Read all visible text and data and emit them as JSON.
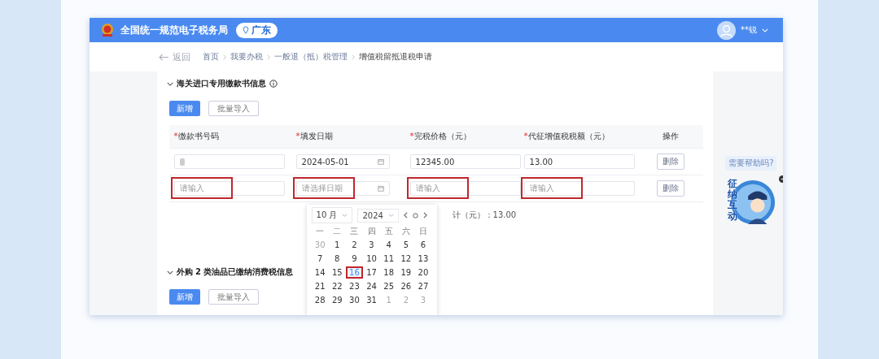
{
  "header": {
    "site_title": "全国统一规范电子税务局",
    "region": "广东",
    "user_name": "**锐"
  },
  "breadcrumb": {
    "back": "返回",
    "items": [
      "首页",
      "我要办税",
      "一般退（抵）税管理",
      "增值税留抵退税申请"
    ]
  },
  "section_1": {
    "title": "海关进口专用缴款书信息",
    "expanded": true,
    "buttons": [
      {
        "label": "新增",
        "kind": "primary"
      },
      {
        "label": "批量导入",
        "kind": "plain"
      }
    ],
    "columns": [
      {
        "mark": "*",
        "label": "缴款书号码"
      },
      {
        "mark": "*",
        "label": "填发日期"
      },
      {
        "mark": "*",
        "label": "完税价格（元）"
      },
      {
        "mark": "*",
        "label": "代征增值税税额（元）"
      },
      {
        "label": "操作"
      }
    ],
    "rows": [
      {
        "cells": [
          {
            "kind": "text",
            "redacted": true,
            "highlighted": false
          },
          {
            "kind": "date",
            "value": "2024-05-01",
            "highlighted": false
          },
          {
            "kind": "text",
            "value": "12345.00",
            "highlighted": false
          },
          {
            "kind": "text",
            "value": "13.00",
            "highlighted": false
          }
        ],
        "action": "删除"
      },
      {
        "cells": [
          {
            "kind": "text",
            "placeholder": "请输入",
            "redacted": false,
            "highlighted": true
          },
          {
            "kind": "date",
            "placeholder": "请选择日期",
            "highlighted": true
          },
          {
            "kind": "text",
            "placeholder": "请输入",
            "highlighted": true
          },
          {
            "kind": "text",
            "placeholder": "请输入",
            "highlighted": true
          }
        ],
        "action": "删除"
      }
    ],
    "summary": "计（元）：13.00"
  },
  "section_2": {
    "title": "外购 2 类油品已缴纳消费税信息",
    "expanded": true,
    "buttons": [
      {
        "label": "新增",
        "kind": "primary"
      },
      {
        "label": "批量导入",
        "kind": "plain"
      }
    ]
  },
  "calendar": {
    "month": "10 月",
    "year": "2024",
    "weekdays": [
      "一",
      "二",
      "三",
      "四",
      "五",
      "六",
      "日"
    ],
    "days": [
      {
        "label": "30",
        "muted": true,
        "highlighted": false
      },
      {
        "label": "1",
        "muted": false,
        "highlighted": false
      },
      {
        "label": "2",
        "muted": false,
        "highlighted": false
      },
      {
        "label": "3",
        "muted": false,
        "highlighted": false
      },
      {
        "label": "4",
        "muted": false,
        "highlighted": false
      },
      {
        "label": "5",
        "muted": false,
        "highlighted": false
      },
      {
        "label": "6",
        "muted": false,
        "highlighted": false
      },
      {
        "label": "7",
        "muted": false,
        "highlighted": false
      },
      {
        "label": "8",
        "muted": false,
        "highlighted": false
      },
      {
        "label": "9",
        "muted": false,
        "highlighted": false
      },
      {
        "label": "10",
        "muted": false,
        "highlighted": false
      },
      {
        "label": "11",
        "muted": false,
        "highlighted": false
      },
      {
        "label": "12",
        "muted": false,
        "highlighted": false
      },
      {
        "label": "13",
        "muted": false,
        "highlighted": false
      },
      {
        "label": "14",
        "muted": false,
        "highlighted": false
      },
      {
        "label": "15",
        "muted": false,
        "highlighted": false
      },
      {
        "label": "16",
        "muted": false,
        "highlighted": true
      },
      {
        "label": "17",
        "muted": false,
        "highlighted": false
      },
      {
        "label": "18",
        "muted": false,
        "highlighted": false
      },
      {
        "label": "19",
        "muted": false,
        "highlighted": false
      },
      {
        "label": "20",
        "muted": false,
        "highlighted": false
      },
      {
        "label": "21",
        "muted": false,
        "highlighted": false
      },
      {
        "label": "22",
        "muted": false,
        "highlighted": false
      },
      {
        "label": "23",
        "muted": false,
        "highlighted": false
      },
      {
        "label": "24",
        "muted": false,
        "highlighted": false
      },
      {
        "label": "25",
        "muted": false,
        "highlighted": false
      },
      {
        "label": "26",
        "muted": false,
        "highlighted": false
      },
      {
        "label": "27",
        "muted": false,
        "highlighted": false
      },
      {
        "label": "28",
        "muted": false,
        "highlighted": false
      },
      {
        "label": "29",
        "muted": false,
        "highlighted": false
      },
      {
        "label": "30",
        "muted": false,
        "highlighted": false
      },
      {
        "label": "31",
        "muted": false,
        "highlighted": false
      },
      {
        "label": "1",
        "muted": true,
        "highlighted": false
      },
      {
        "label": "2",
        "muted": true,
        "highlighted": false
      },
      {
        "label": "3",
        "muted": true,
        "highlighted": false
      }
    ]
  },
  "assistant": {
    "tooltip": "需要帮助吗?",
    "label": "征纳互动"
  }
}
